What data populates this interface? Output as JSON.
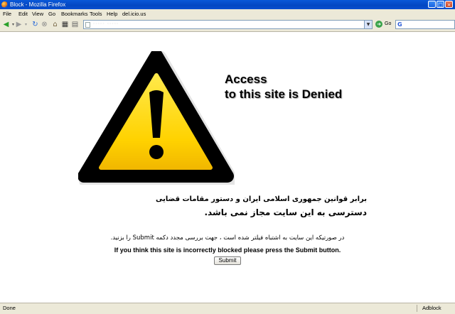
{
  "window": {
    "title": "Block - Mozilla Firefox"
  },
  "menu": [
    "File",
    "Edit",
    "View",
    "Go",
    "Bookmarks",
    "Tools",
    "Help",
    "del.icio.us"
  ],
  "toolbar": {
    "go_label": "Go",
    "url_placeholder": "····· ·····"
  },
  "page": {
    "headline_line1": "Access",
    "headline_line2": "to this site is Denied",
    "fa_line1": "برابر قوانين جمهوری اسلامی ايران و دستور مقامات قضايی",
    "fa_line2": "دسترسی به اين سايت مجاز نمی باشد.",
    "fa_line3": "در صورتيکه اين سايت به اشتباه فيلتر شده است ، جهت بررسی مجدد دکمه Submit را بزنيد.",
    "en_line": "If you think this site is incorrectly blocked please press the Submit button.",
    "submit_label": "Submit"
  },
  "status": {
    "text": "Done",
    "addon": "Adblock"
  },
  "colors": {
    "sign_yellow": "#ffd200",
    "sign_border": "#000000",
    "titlebar": "#0a4fd0"
  },
  "icons": [
    "firefox-icon",
    "back-icon",
    "forward-icon",
    "reload-icon",
    "stop-icon",
    "home-icon",
    "bookmark-icon",
    "page-icon",
    "go-icon",
    "google-icon",
    "warning-icon"
  ]
}
